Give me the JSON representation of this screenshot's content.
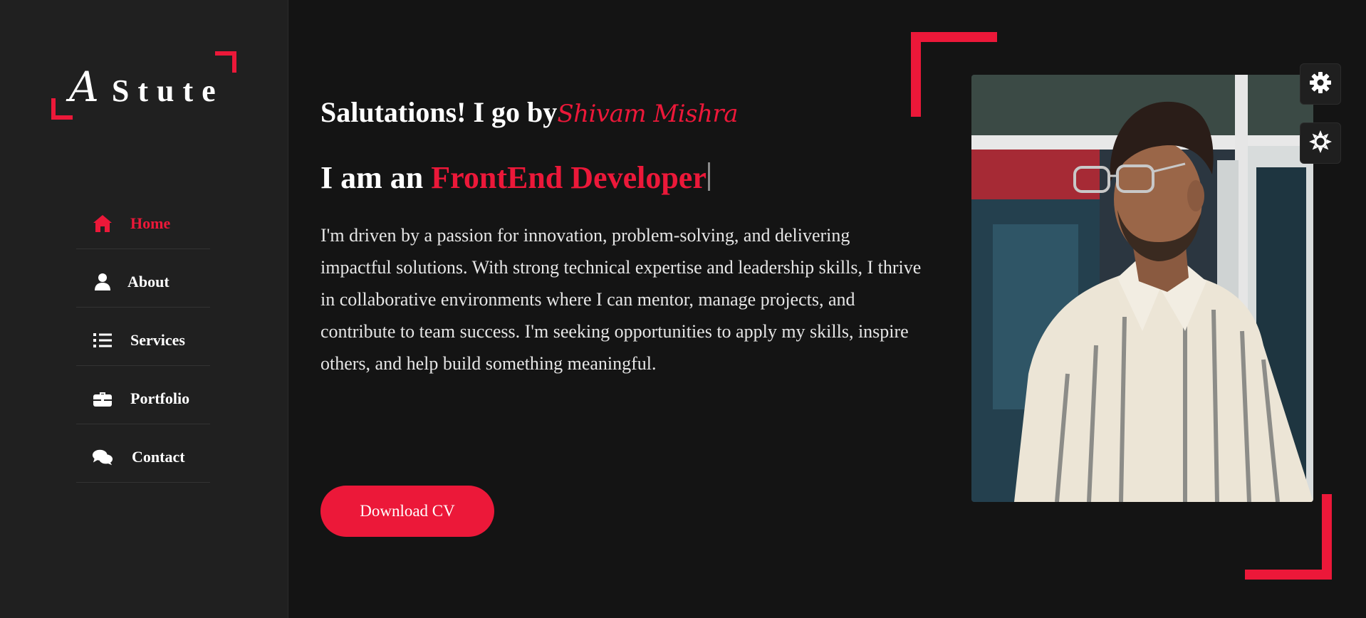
{
  "colors": {
    "accent": "#ec1839",
    "background": "#141414",
    "sidebar": "#202020"
  },
  "logo": {
    "letter": "A",
    "word": "Stute"
  },
  "nav": {
    "items": [
      {
        "label": "Home",
        "icon": "home-icon",
        "active": true
      },
      {
        "label": "About",
        "icon": "user-icon",
        "active": false
      },
      {
        "label": "Services",
        "icon": "list-icon",
        "active": false
      },
      {
        "label": "Portfolio",
        "icon": "briefcase-icon",
        "active": false
      },
      {
        "label": "Contact",
        "icon": "comments-icon",
        "active": false
      }
    ]
  },
  "hero": {
    "greeting": "Salutations! I go by",
    "name": "Shivam Mishra",
    "role_prefix": "I am an ",
    "role": "FrontEnd Developer",
    "bio": "I'm driven by a passion for innovation, problem-solving, and delivering impactful solutions. With strong technical expertise and leadership skills, I thrive in collaborative environments where I can mentor, manage projects, and contribute to team success. I'm seeking opportunities to apply my skills, inspire others, and help build something meaningful.",
    "cta": "Download CV"
  },
  "toolbar": {
    "settings_icon": "gear-icon",
    "theme_icon": "sun-icon"
  }
}
